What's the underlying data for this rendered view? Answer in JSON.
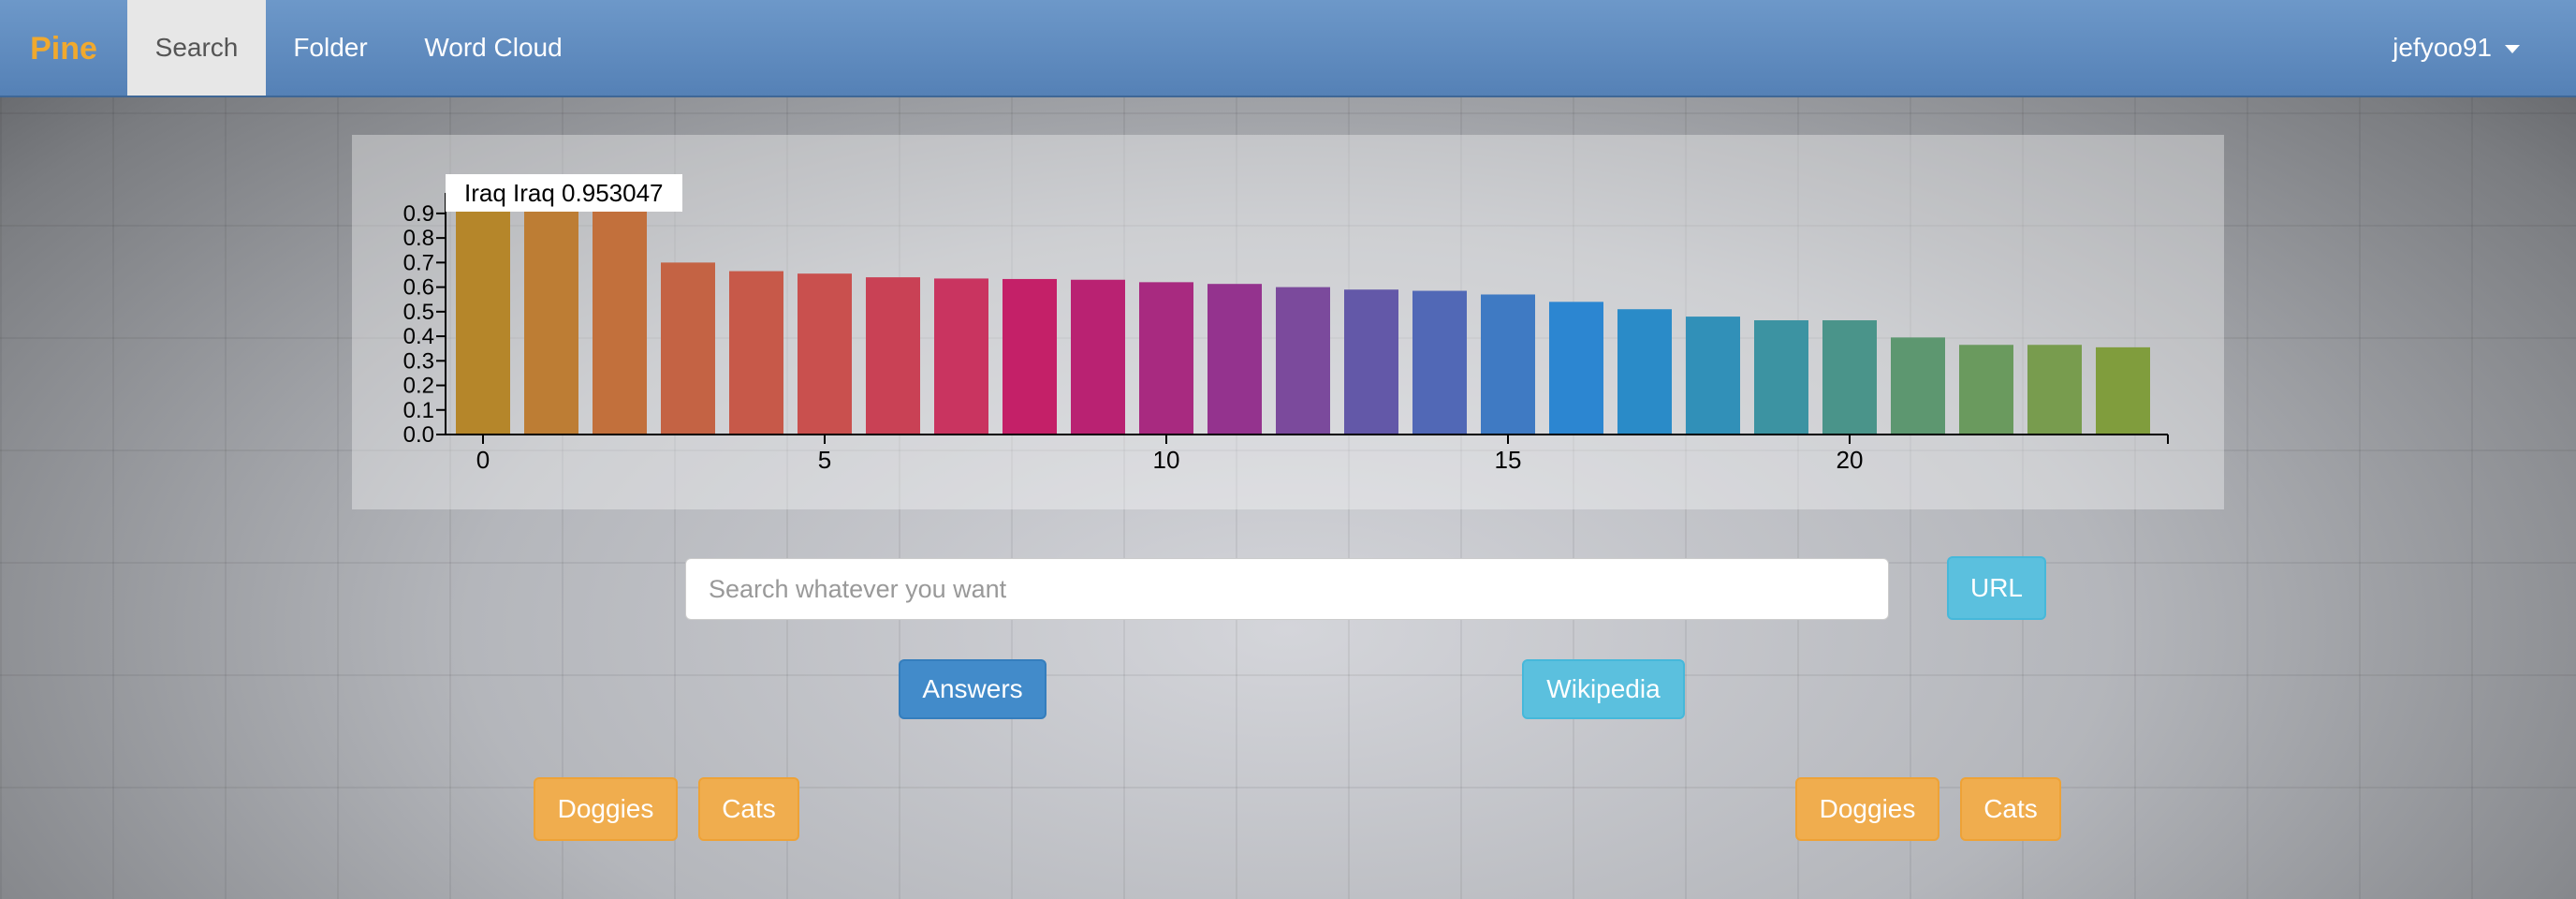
{
  "navbar": {
    "brand": "Pine",
    "items": [
      {
        "label": "Search",
        "active": true
      },
      {
        "label": "Folder",
        "active": false
      },
      {
        "label": "Word Cloud",
        "active": false
      }
    ],
    "user": "jefyoo91"
  },
  "tooltip": "Iraq Iraq 0.953047",
  "search": {
    "placeholder": "Search whatever you want",
    "url_button": "URL"
  },
  "sources": {
    "answers": "Answers",
    "wikipedia": "Wikipedia"
  },
  "left_tags": [
    "Doggies",
    "Cats"
  ],
  "right_tags": [
    "Doggies",
    "Cats"
  ],
  "chart_data": {
    "type": "bar",
    "categories": [
      0,
      1,
      2,
      3,
      4,
      5,
      6,
      7,
      8,
      9,
      10,
      11,
      12,
      13,
      14,
      15,
      16,
      17,
      18,
      19,
      20,
      21,
      22,
      23,
      24
    ],
    "values": [
      0.953,
      0.953,
      0.953,
      0.7,
      0.665,
      0.655,
      0.64,
      0.635,
      0.633,
      0.63,
      0.62,
      0.613,
      0.6,
      0.59,
      0.585,
      0.57,
      0.54,
      0.51,
      0.48,
      0.465,
      0.465,
      0.395,
      0.365,
      0.365,
      0.355
    ],
    "colors": [
      "#b5862a",
      "#bd7d34",
      "#c2703c",
      "#c46344",
      "#c75949",
      "#c9504e",
      "#c94155",
      "#c93460",
      "#c42068",
      "#b92272",
      "#a82a80",
      "#94338e",
      "#7b4a9c",
      "#6358a8",
      "#5168b6",
      "#3f7ac3",
      "#2c86d1",
      "#2a8bc8",
      "#3190b8",
      "#3c93a2",
      "#4a948a",
      "#5d9770",
      "#6a9a5e",
      "#789c4e",
      "#809d3d"
    ],
    "xticks": [
      0,
      5,
      10,
      15,
      20
    ],
    "yticks": [
      "0.0",
      "0.1",
      "0.2",
      "0.3",
      "0.4",
      "0.5",
      "0.6",
      "0.7",
      "0.8",
      "0.9"
    ],
    "ylim": [
      0,
      0.953
    ],
    "xlabel": "",
    "ylabel": "",
    "grid": false
  }
}
